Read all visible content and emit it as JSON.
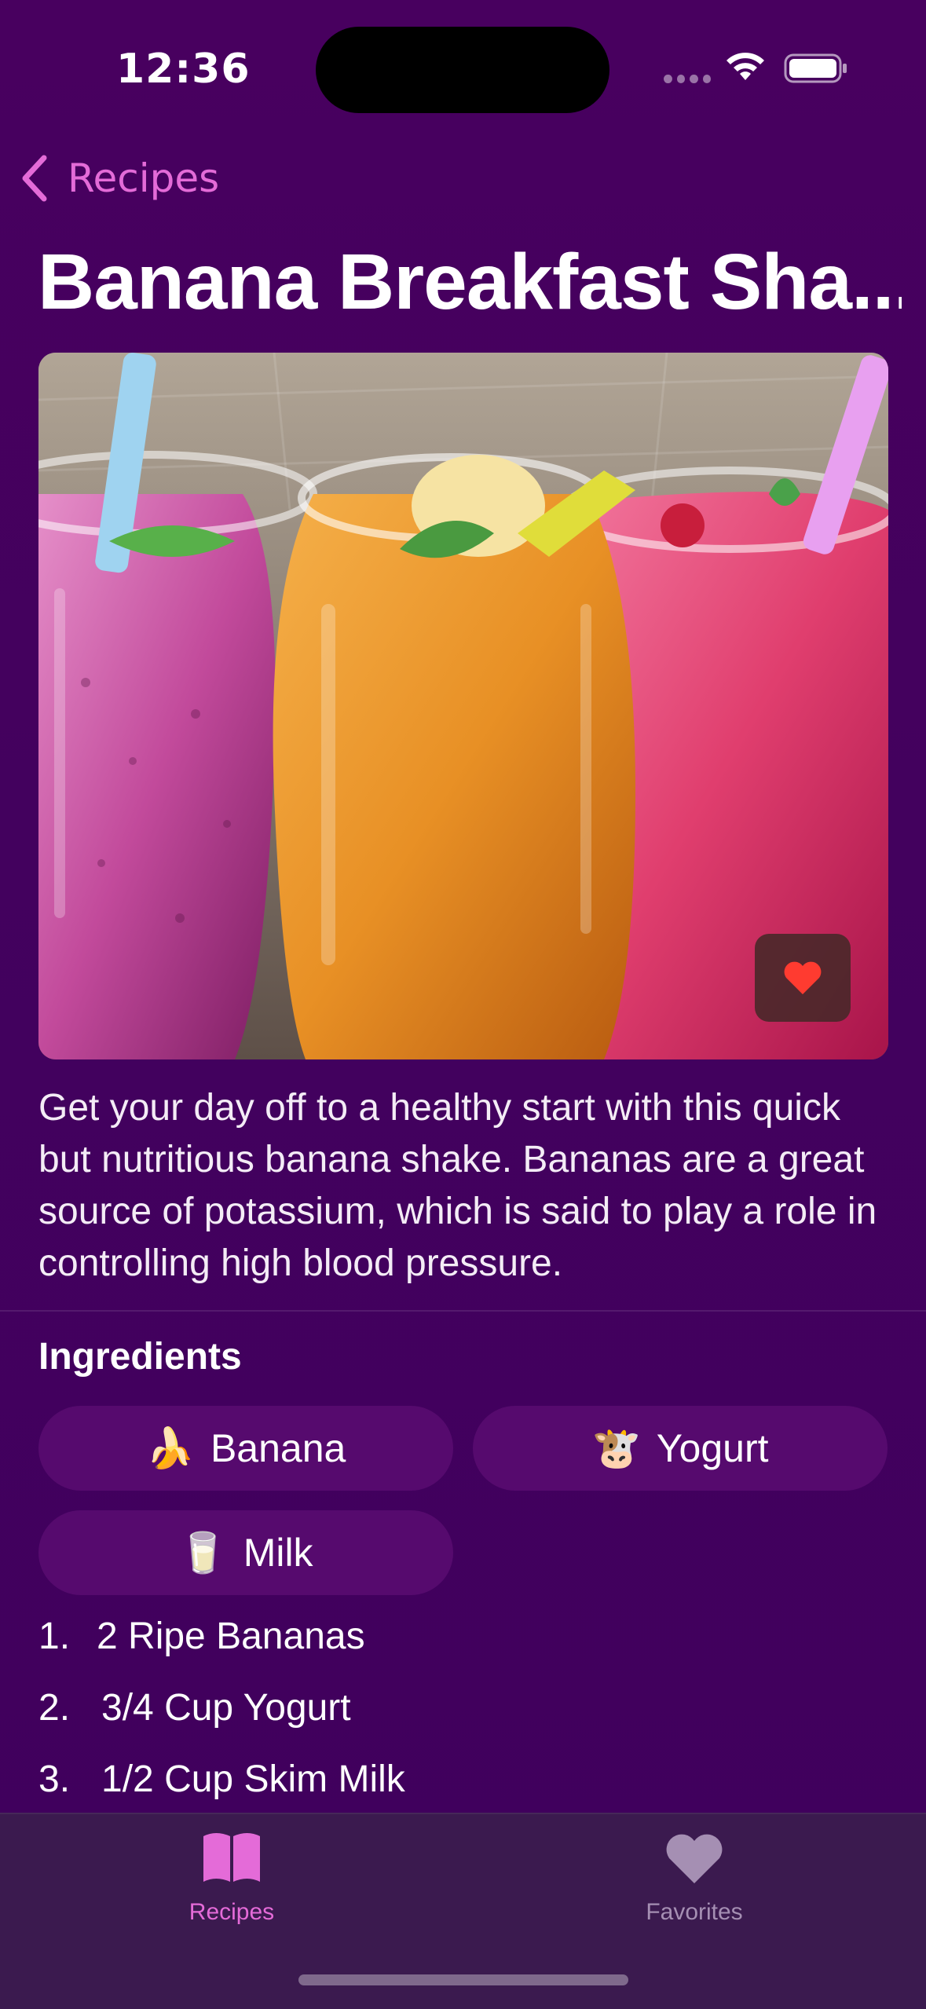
{
  "status_bar": {
    "time": "12:36",
    "wifi_icon": "wifi-icon",
    "battery_icon": "battery-full-icon"
  },
  "nav": {
    "back_label": "Recipes",
    "back_icon": "chevron-left-icon"
  },
  "recipe": {
    "title": "Banana Breakfast Sha...",
    "image_alt": "Three jars of fruit smoothies with straws",
    "favorite_icon": "heart-filled-icon",
    "description": "Get your day off to a healthy start with this quick but nutritious banana shake. Bananas are a great source of potassium, which is said to play a role in controlling high blood pressure."
  },
  "ingredients": {
    "title": "Ingredients",
    "chips": [
      {
        "icon": "🍌",
        "label": "Banana"
      },
      {
        "icon": "🐮",
        "label": "Yogurt"
      },
      {
        "icon": "🥛",
        "label": "Milk"
      }
    ],
    "list": [
      {
        "num": "1.",
        "text": "2 Ripe Bananas"
      },
      {
        "num": "2.",
        "text": "3/4 Cup Yogurt"
      },
      {
        "num": "3.",
        "text": "1/2 Cup Skim Milk"
      }
    ]
  },
  "tab_bar": {
    "tabs": [
      {
        "label": "Recipes",
        "icon": "book-icon",
        "selected": true
      },
      {
        "label": "Favorites",
        "icon": "heart-icon",
        "selected": false
      }
    ]
  },
  "colors": {
    "background": "#43025f",
    "accent": "#e46bd8",
    "chip": "#560a6e",
    "tab_bar": "#3b1a4f",
    "favorite_heart": "#ff3b30"
  }
}
